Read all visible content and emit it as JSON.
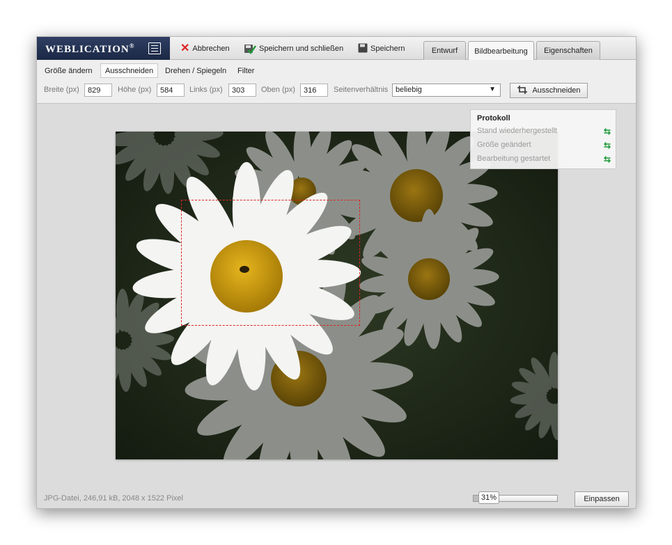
{
  "app": {
    "brand": "Weblication",
    "brand_mark": "®"
  },
  "toolbar": {
    "cancel_label": "Abbrechen",
    "save_close_label": "Speichern und schließen",
    "save_label": "Speichern"
  },
  "tabs": [
    {
      "label": "Entwurf",
      "active": false
    },
    {
      "label": "Bildbearbeitung",
      "active": true
    },
    {
      "label": "Eigenschaften",
      "active": false
    }
  ],
  "subtabs": [
    {
      "label": "Größe ändern",
      "active": false
    },
    {
      "label": "Ausschneiden",
      "active": true
    },
    {
      "label": "Drehen / Spiegeln",
      "active": false
    },
    {
      "label": "Filter",
      "active": false
    }
  ],
  "crop": {
    "width_label": "Breite (px)",
    "width_value": "829",
    "height_label": "Höhe (px)",
    "height_value": "584",
    "left_label": "Links (px)",
    "left_value": "303",
    "top_label": "Oben (px)",
    "top_value": "316",
    "aspect_label": "Seitenverhältnis",
    "aspect_value": "beliebig",
    "button_label": "Ausschneiden"
  },
  "protocol": {
    "title": "Protokoll",
    "items": [
      {
        "label": "Stand wiederhergestellt",
        "icon": "restore-icon"
      },
      {
        "label": "Größe geändert",
        "icon": "restore-icon"
      },
      {
        "label": "Bearbeitung gestartet",
        "icon": "restore-icon"
      }
    ]
  },
  "status": {
    "file_info": "JPG-Datei, 246,91 kB, 2048 x 1522 Pixel"
  },
  "zoom": {
    "value": "31%",
    "fraction": 0.31,
    "fit_label": "Einpassen"
  },
  "colors": {
    "brand": "#1b2845",
    "accent_red": "#d22222",
    "restore_green": "#1f9a3a"
  }
}
